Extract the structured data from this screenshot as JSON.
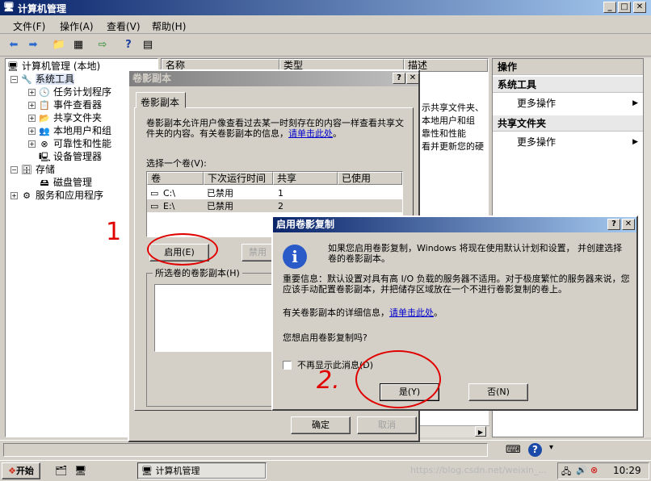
{
  "window": {
    "title": "计算机管理",
    "icon": "computer-management-icon"
  },
  "menu": [
    "文件(F)",
    "操作(A)",
    "查看(V)",
    "帮助(H)"
  ],
  "tree": {
    "root": "计算机管理 (本地)",
    "system_tools": "系统工具",
    "task_scheduler": "任务计划程序",
    "event_viewer": "事件查看器",
    "shared_folders": "共享文件夹",
    "local_users": "本地用户和组",
    "reliability": "可靠性和性能",
    "device_manager": "设备管理器",
    "storage": "存储",
    "disk_mgmt": "磁盘管理",
    "services_apps": "服务和应用程序"
  },
  "list": {
    "headers": [
      "名称",
      "类型",
      "描述"
    ],
    "rows": [
      "示共享文件夹、",
      "本地用户和组",
      "靠性和性能",
      "看并更新您的硬"
    ]
  },
  "actions": {
    "header": "操作",
    "section1": "系统工具",
    "more1": "更多操作",
    "section2": "共享文件夹",
    "more2": "更多操作"
  },
  "shadow_dialog": {
    "title": "卷影副本",
    "tab": "卷影副本",
    "desc": "卷影副本允许用户像查看过去某一时刻存在的内容一样查看共享文件夹的内容。有关卷影副本的信息，",
    "desc_link": "请单击此处",
    "desc_end": "。",
    "select_label": "选择一个卷(V):",
    "columns": [
      "卷",
      "下次运行时间",
      "共享",
      "已使用"
    ],
    "volumes": [
      {
        "vol": "C:\\",
        "next": "已禁用",
        "shares": "1",
        "used": ""
      },
      {
        "vol": "E:\\",
        "next": "已禁用",
        "shares": "2",
        "used": ""
      }
    ],
    "enable_btn": "启用(E)",
    "disable_btn": "禁用",
    "group_label": "所选卷的卷影副本(H)",
    "ok_btn": "确定",
    "cancel_btn": "取消"
  },
  "enable_dialog": {
    "title": "启用卷影复制",
    "line1": "如果您启用卷影复制，Windows 将现在使用默认计划和设置， 并创建选择卷的卷影副本。",
    "line2": "重要信息：默认设置对具有高 I/O 负载的服务器不适用。对于极度繁忙的服务器来说，您应该手动配置卷影副本，并把储存区域放在一个不进行卷影复制的卷上。",
    "line3": "有关卷影副本的详细信息，",
    "line3_link": "请单击此处",
    "line3_end": "。",
    "question": "您想启用卷影复制吗?",
    "checkbox": "不再显示此消息(D)",
    "yes_btn": "是(Y)",
    "no_btn": "否(N)"
  },
  "annotations": {
    "mark1": "1",
    "mark2": "2."
  },
  "taskbar": {
    "start": "开始",
    "task": "计算机管理",
    "time": "10:29",
    "watermark": "https://blog.csdn.net/weixin_..."
  },
  "colors": {
    "title_active": "#0a246a",
    "title_gradient_end": "#a6caf0",
    "annotation_red": "#e00000",
    "link": "#0000cc"
  }
}
